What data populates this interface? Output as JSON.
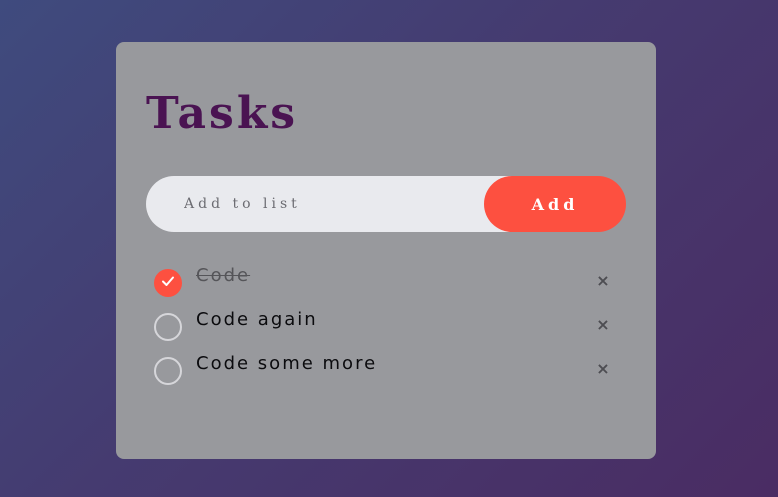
{
  "title": "Tasks",
  "input": {
    "placeholder": "Add to list",
    "value": ""
  },
  "add_button_label": "Add",
  "tasks": [
    {
      "text": "Code",
      "done": true,
      "remove_symbol": "×"
    },
    {
      "text": "Code again",
      "done": false,
      "remove_symbol": "×"
    },
    {
      "text": "Code some more",
      "done": false,
      "remove_symbol": "×"
    }
  ],
  "colors": {
    "accent": "#fd5040",
    "title": "#4a1352",
    "card": "#98999d",
    "background_start": "#3f4b7e",
    "background_end": "#4a2c63"
  },
  "icons": {
    "checked": "check-icon",
    "remove": "close-icon"
  }
}
